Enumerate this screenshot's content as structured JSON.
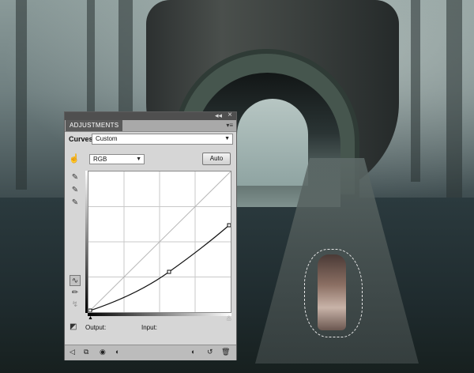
{
  "panel": {
    "tab_label": "ADJUSTMENTS",
    "collapse_glyph": "◂◂",
    "close_glyph": "×",
    "menu_glyph": "▾≡",
    "adjustment_name": "Curves",
    "preset_value": "Custom",
    "channel_value": "RGB",
    "auto_label": "Auto",
    "output_label": "Output:",
    "input_label": "Input:"
  },
  "icons": {
    "targeted_adjust": "☝",
    "eyedropper": "✎",
    "curve_tool": "∿",
    "pencil": "✏",
    "smooth": "↯",
    "clipping": "◩",
    "dropdown": "▼"
  },
  "bottom_icons": [
    "back-arrow-icon",
    "layer-clip-icon",
    "visibility-eye-icon",
    "view-previous-icon",
    "reset-icon",
    "trash-icon"
  ],
  "bottom_glyphs": [
    "◁",
    "⧉",
    "◉",
    "◐",
    "↺",
    "🗑"
  ],
  "colors": {
    "panel_bg": "#d6d6d6",
    "tab_bg": "#5a5a5a",
    "curve": "#111111"
  }
}
